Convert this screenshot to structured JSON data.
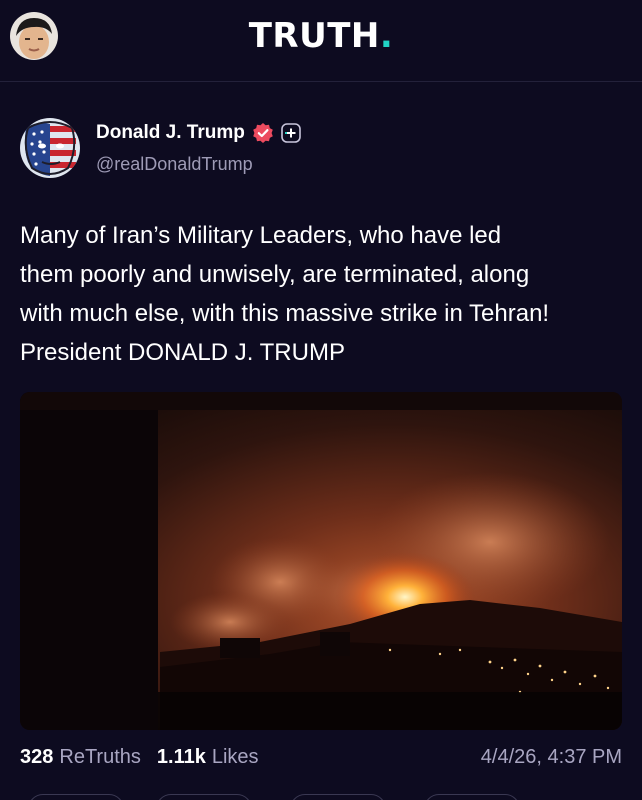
{
  "app": {
    "logo_text": "TRUTH",
    "logo_dot": ".",
    "accent": "#21d4c5"
  },
  "post": {
    "author": {
      "name": "Donald J. Trump",
      "handle": "@realDonaldTrump",
      "verified_icon": "verified-badge-icon",
      "verified_color": "#ec4b5f"
    },
    "text_lines": [
      "Many of Iran’s Military Leaders, who have led",
      "them poorly and unwisely, are terminated, along",
      "with much else, with this massive strike in Tehran!",
      "President DONALD J. TRUMP"
    ],
    "media": {
      "kind": "image",
      "icon": "night-explosion-photo"
    },
    "stats": {
      "retruths_count": "328",
      "retruths_label": "ReTruths",
      "likes_count": "1.11k",
      "likes_label": "Likes",
      "timestamp": "4/4/26, 4:37 PM"
    }
  }
}
